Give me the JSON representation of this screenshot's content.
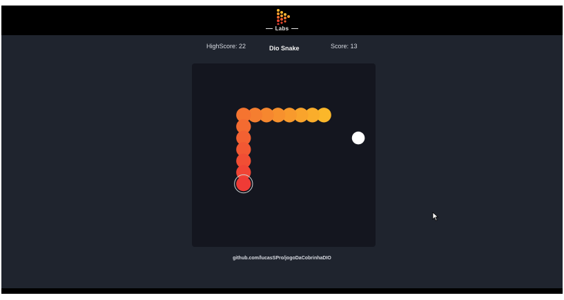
{
  "header": {
    "brand_text": "Labs"
  },
  "hud": {
    "highscore_label": "HighScore: 22",
    "title": "Dio Snake",
    "score_label": "Score: 13"
  },
  "game": {
    "grid_size": 16,
    "snake_color_head": "#ef3b36",
    "snake_color_tail": "#fbb72a",
    "food_color": "#ffffff",
    "snake": [
      {
        "col": 4,
        "row": 10
      },
      {
        "col": 4,
        "row": 9
      },
      {
        "col": 4,
        "row": 8
      },
      {
        "col": 4,
        "row": 7
      },
      {
        "col": 4,
        "row": 6
      },
      {
        "col": 4,
        "row": 5
      },
      {
        "col": 4,
        "row": 4
      },
      {
        "col": 5,
        "row": 4
      },
      {
        "col": 6,
        "row": 4
      },
      {
        "col": 7,
        "row": 4
      },
      {
        "col": 8,
        "row": 4
      },
      {
        "col": 9,
        "row": 4
      },
      {
        "col": 10,
        "row": 4
      },
      {
        "col": 11,
        "row": 4
      }
    ],
    "food": {
      "col": 14,
      "row": 6
    }
  },
  "footer": {
    "link_text": "github.com/lucasSPro/jogoDaCobrinhaDIO"
  }
}
